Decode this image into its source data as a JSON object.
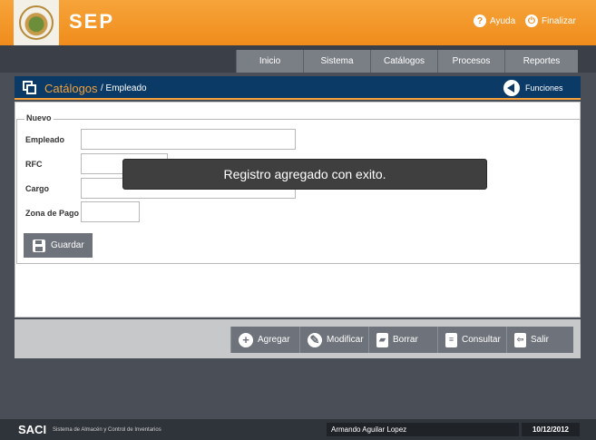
{
  "header": {
    "brand": "SEP",
    "help_label": "Ayuda",
    "logout_label": "Finalizar"
  },
  "nav": {
    "items": [
      {
        "label": "Inicio"
      },
      {
        "label": "Sistema"
      },
      {
        "label": "Catálogos"
      },
      {
        "label": "Procesos"
      },
      {
        "label": "Reportes"
      }
    ]
  },
  "breadcrumb": {
    "title": "Catálogos",
    "sub": "/ Empleado",
    "functions_label": "Funciones"
  },
  "form": {
    "legend": "Nuevo",
    "fields": [
      {
        "label": "Empleado",
        "value": ""
      },
      {
        "label": "RFC",
        "value": ""
      },
      {
        "label": "Cargo",
        "value": ""
      },
      {
        "label": "Zona de Pago",
        "value": ""
      }
    ],
    "save_label": "Guardar"
  },
  "toast": {
    "message": "Registro agregado con exito."
  },
  "toolbar": {
    "add_label": "Agregar",
    "edit_label": "Modificar",
    "delete_label": "Borrar",
    "query_label": "Consultar",
    "exit_label": "Salir"
  },
  "footer": {
    "app_name": "SACI",
    "app_full": "Sistema de Almacén y Control de Inventarios",
    "user": "Armando Aguilar Lopez",
    "date": "10/12/2012"
  },
  "colors": {
    "header_orange": "#f08c1c",
    "crumb_blue": "#0b3a66",
    "button_gray": "#6e727a"
  }
}
